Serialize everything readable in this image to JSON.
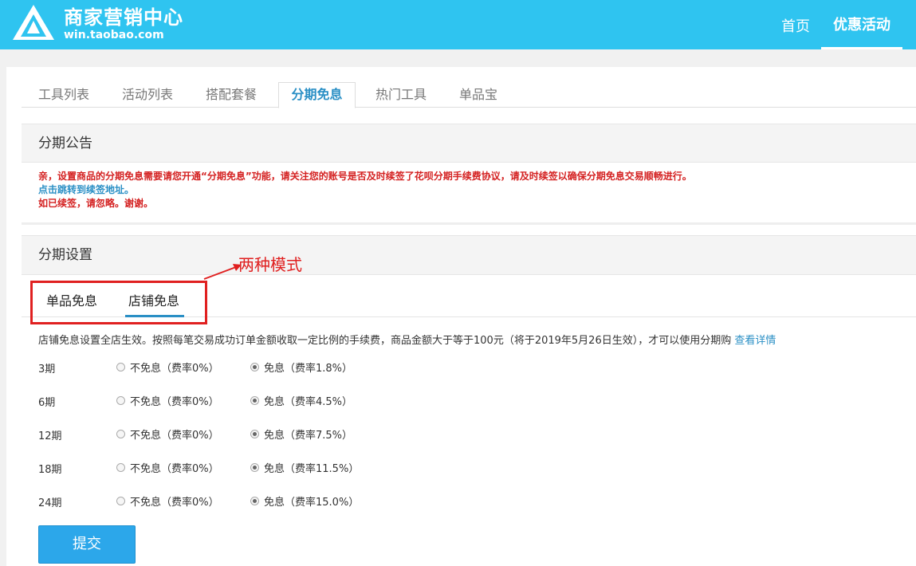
{
  "header": {
    "brand_name": "商家营销中心",
    "brand_url": "win.taobao.com",
    "nav": {
      "home": "首页",
      "promotions": "优惠活动"
    }
  },
  "tabs": [
    {
      "label": "工具列表"
    },
    {
      "label": "活动列表"
    },
    {
      "label": "搭配套餐"
    },
    {
      "label": "分期免息",
      "active": true
    },
    {
      "label": "热门工具"
    },
    {
      "label": "单品宝"
    }
  ],
  "announcement": {
    "title": "分期公告",
    "line1": "亲，设置商品的分期免息需要请您开通“分期免息”功能，请关注您的账号是否及时续签了花呗分期手续费协议，请及时续签以确保分期免息交易顺畅进行。",
    "link": "点击跳转到续签地址。",
    "line3": "如已续签，请忽略。谢谢。"
  },
  "settings": {
    "title": "分期设置",
    "annotation": "两种模式",
    "subtabs": {
      "single": "单品免息",
      "store": "店铺免息",
      "active": "store"
    },
    "description": "店铺免息设置全店生效。按照每笔交易成功订单金额收取一定比例的手续费，商品金额大于等于100元（将于2019年5月26日生效），才可以使用分期购",
    "detail_link": "查看详情",
    "rows": [
      {
        "period": "3期",
        "opt_no": "不免息（费率0%）",
        "opt_yes": "免息（费率1.8%）",
        "selected": "yes"
      },
      {
        "period": "6期",
        "opt_no": "不免息（费率0%）",
        "opt_yes": "免息（费率4.5%）",
        "selected": "yes"
      },
      {
        "period": "12期",
        "opt_no": "不免息（费率0%）",
        "opt_yes": "免息（费率7.5%）",
        "selected": "yes"
      },
      {
        "period": "18期",
        "opt_no": "不免息（费率0%）",
        "opt_yes": "免息（费率11.5%）",
        "selected": "yes"
      },
      {
        "period": "24期",
        "opt_no": "不免息（费率0%）",
        "opt_yes": "免息（费率15.0%）",
        "selected": "yes"
      }
    ],
    "submit_label": "提交"
  },
  "colors": {
    "header": "#2fc4f0",
    "accent": "#2a8fc5",
    "alert": "#d42121",
    "button": "#2ca7ea"
  }
}
